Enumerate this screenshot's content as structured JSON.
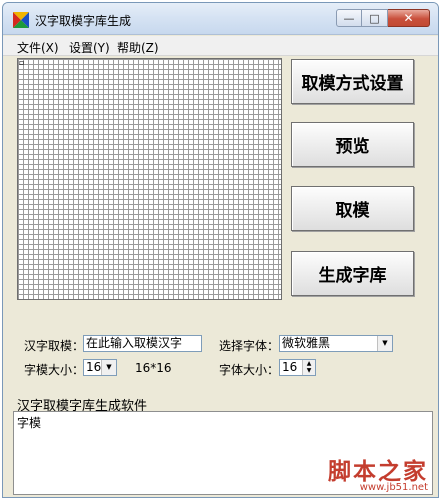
{
  "window": {
    "title": "汉字取模字库生成",
    "controls": {
      "minimize": "—",
      "maximize": "□",
      "close": "✕"
    }
  },
  "menu": {
    "items": [
      "文件(X)",
      "设置(Y)",
      "帮助(Z)"
    ]
  },
  "canvas": {
    "marker": "▫",
    "grid_color": "#9a9a9a"
  },
  "buttons": {
    "mode_settings": "取模方式设置",
    "preview": "预览",
    "extract": "取模",
    "generate": "生成字库"
  },
  "form": {
    "char_extract_label": "汉字取模：",
    "char_extract_value": "在此输入取模汉字",
    "font_select_label": "选择字体：",
    "font_select_value": "微软雅黑",
    "glyph_size_label": "字模大小：",
    "glyph_size_value": "16",
    "glyph_size_display": "16*16",
    "font_size_label": "字体大小：",
    "font_size_value": "16"
  },
  "output": {
    "section_label": "汉字取模字库生成软件",
    "text": "字模"
  },
  "watermark": {
    "main": "脚本之家",
    "url": "www.jb51.net"
  },
  "colors": {
    "title_bar": "#d6e3f3",
    "close_button": "#c9503c",
    "watermark": "#c43d2e"
  }
}
